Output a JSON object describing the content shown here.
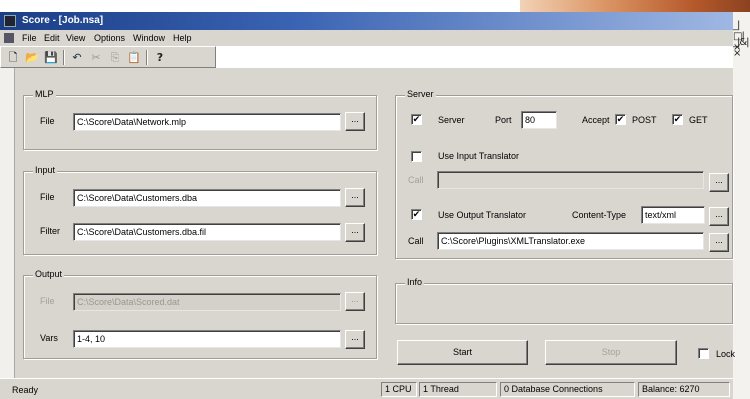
{
  "window": {
    "title": "Score - [Job.nsa]"
  },
  "mdi_controls": {
    "row1": "_|□|×",
    "row2": "_|&|×"
  },
  "menu": [
    "File",
    "Edit",
    "View",
    "Options",
    "Window",
    "Help"
  ],
  "toolbar": [
    "new-icon",
    "open-icon",
    "save-icon",
    "undo-icon",
    "cut-icon",
    "copy-icon",
    "paste-icon",
    "help-icon"
  ],
  "mlp": {
    "title": "MLP",
    "file_label": "File",
    "file_value": "C:\\Score\\Data\\Network.mlp"
  },
  "input": {
    "title": "Input",
    "file_label": "File",
    "file_value": "C:\\Score\\Data\\Customers.dba",
    "filter_label": "Filter",
    "filter_value": "C:\\Score\\Data\\Customers.dba.fil"
  },
  "output": {
    "title": "Output",
    "file_label": "File",
    "file_value": "C:\\Score\\Data\\Scored.dat",
    "vars_label": "Vars",
    "vars_value": "1-4, 10"
  },
  "server": {
    "title": "Server",
    "server_label": "Server",
    "server_checked": true,
    "port_label": "Port",
    "port_value": "80",
    "accept_label": "Accept",
    "post_label": "POST",
    "post_checked": true,
    "get_label": "GET",
    "get_checked": true,
    "use_input_label": "Use Input Translator",
    "use_input_checked": false,
    "call_label": "Call",
    "input_call_value": "",
    "use_output_label": "Use Output Translator",
    "use_output_checked": true,
    "content_type_label": "Content-Type",
    "content_type_value": "text/xml",
    "output_call_value": "C:\\Score\\Plugins\\XMLTranslator.exe"
  },
  "info": {
    "title": "Info"
  },
  "buttons": {
    "browse": "...",
    "start": "Start",
    "stop": "Stop",
    "lock": "Lock"
  },
  "status": {
    "ready": "Ready",
    "cpu": "1 CPU",
    "thread": "1 Thread",
    "db": "0 Database Connections",
    "balance": "Balance: 6270"
  }
}
